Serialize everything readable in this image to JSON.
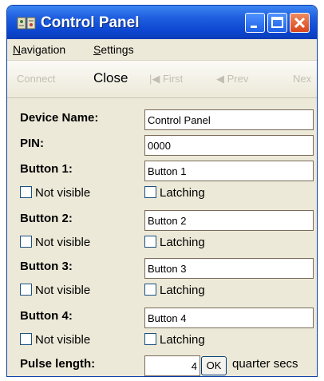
{
  "window": {
    "title": "Control Panel",
    "icon": "control-panel-icon",
    "controls": [
      "minimize-icon",
      "maximize-icon",
      "close-icon"
    ],
    "accent": "#0d47d1",
    "close_color": "#d8461c"
  },
  "menu": {
    "navigation_first": "N",
    "navigation_rest": "avigation",
    "settings_first": "S",
    "settings_rest": "ettings"
  },
  "toolbar": {
    "connect": "Connect",
    "close": "Close",
    "first": "|◀ First",
    "prev": "◀ Prev",
    "next": "Nex"
  },
  "form": {
    "device_name_label": "Device Name:",
    "device_name_value": "Control Panel",
    "pin_label": "PIN:",
    "pin_value": "0000",
    "buttons": [
      {
        "label": "Button 1:",
        "value": "Button 1",
        "not_visible": "Not visible",
        "latching": "Latching"
      },
      {
        "label": "Button 2:",
        "value": "Button 2",
        "not_visible": "Not visible",
        "latching": "Latching"
      },
      {
        "label": "Button 3:",
        "value": "Button 3",
        "not_visible": "Not visible",
        "latching": "Latching"
      },
      {
        "label": "Button 4:",
        "value": "Button 4",
        "not_visible": "Not visible",
        "latching": "Latching"
      }
    ],
    "pulse_label": "Pulse length:",
    "pulse_value": "4",
    "ok_label": "OK",
    "pulse_unit": "quarter secs"
  }
}
